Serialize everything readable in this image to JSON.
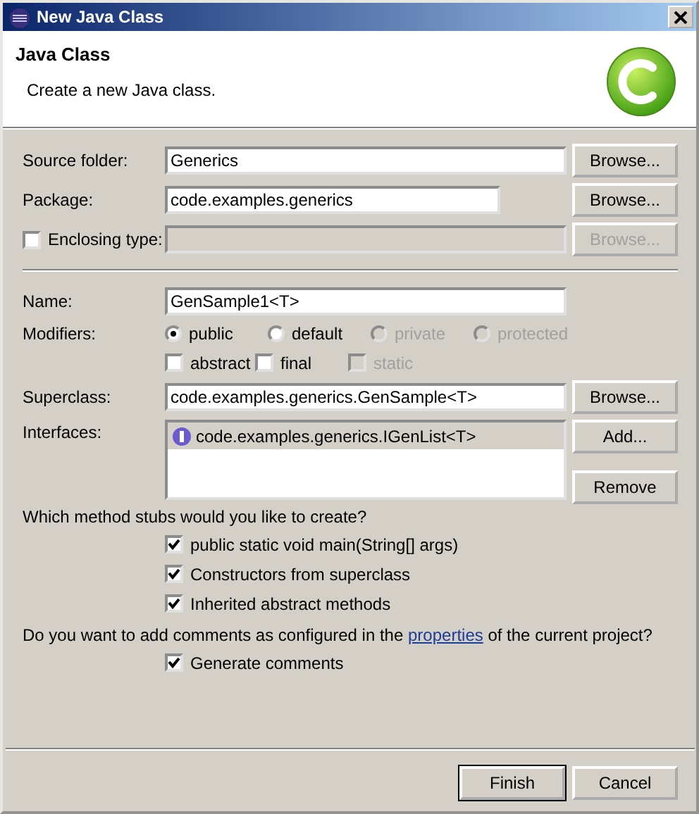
{
  "window": {
    "title": "New Java Class"
  },
  "header": {
    "title": "Java Class",
    "description": "Create a new Java class."
  },
  "source_folder": {
    "label": "Source folder:",
    "value": "Generics",
    "button": "Browse..."
  },
  "package": {
    "label": "Package:",
    "value": "code.examples.generics",
    "button": "Browse..."
  },
  "enclosing_type": {
    "label": "Enclosing type:",
    "checked": false,
    "value_disabled": true,
    "button": "Browse...",
    "button_disabled": true
  },
  "name": {
    "label": "Name:",
    "value": "GenSample1<T>"
  },
  "modifiers": {
    "label": "Modifiers:",
    "visibility": [
      {
        "label": "public",
        "selected": true,
        "disabled": false
      },
      {
        "label": "default",
        "selected": false,
        "disabled": false
      },
      {
        "label": "private",
        "selected": false,
        "disabled": true
      },
      {
        "label": "protected",
        "selected": false,
        "disabled": true
      }
    ],
    "flags": [
      {
        "label": "abstract",
        "checked": false,
        "disabled": false
      },
      {
        "label": "final",
        "checked": false,
        "disabled": false
      },
      {
        "label": "static",
        "checked": false,
        "disabled": true
      }
    ]
  },
  "superclass": {
    "label": "Superclass:",
    "value": "code.examples.generics.GenSample<T>",
    "button": "Browse..."
  },
  "interfaces": {
    "label": "Interfaces:",
    "items": [
      {
        "name": "code.examples.generics.IGenList<T>",
        "selected": true
      }
    ],
    "buttons": [
      "Add...",
      "Remove"
    ]
  },
  "stubs": {
    "question": "Which method stubs would you like to create?",
    "options": [
      {
        "label": "public static void main(String[] args)",
        "checked": true
      },
      {
        "label": "Constructors from superclass",
        "checked": true
      },
      {
        "label": "Inherited abstract methods",
        "checked": true
      }
    ]
  },
  "comments": {
    "question_before": "Do you want to add comments as configured in the ",
    "link": "properties",
    "question_after": " of the current project?",
    "options": [
      {
        "label": "Generate comments",
        "checked": true
      }
    ]
  },
  "buttons": [
    {
      "label": "Finish",
      "default": true
    },
    {
      "label": "Cancel",
      "default": false
    }
  ]
}
